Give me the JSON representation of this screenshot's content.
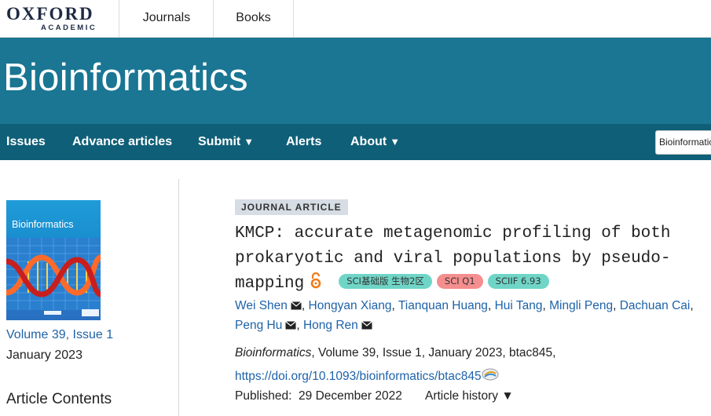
{
  "topbar": {
    "logo_main": "OXFORD",
    "logo_sub": "ACADEMIC",
    "links": [
      "Journals",
      "Books"
    ]
  },
  "banner": {
    "title": "Bioinformatics"
  },
  "nav": {
    "items": [
      {
        "label": "Issues",
        "dropdown": false
      },
      {
        "label": "Advance articles",
        "dropdown": false
      },
      {
        "label": "Submit",
        "dropdown": true
      },
      {
        "label": "Alerts",
        "dropdown": false
      },
      {
        "label": "About",
        "dropdown": true
      }
    ],
    "search_value": "Bioinformatics"
  },
  "sidebar": {
    "cover_title": "Bioinformatics",
    "volume_link": "Volume 39, Issue 1",
    "date": "January 2023",
    "contents_heading": "Article Contents"
  },
  "article": {
    "type_tag": "JOURNAL ARTICLE",
    "title": "KMCP: accurate metagenomic profiling of both prokaryotic and viral populations by pseudo-mapping",
    "badges": [
      "SCI基础版 生物2区",
      "SCI Q1",
      "SCIIF 6.93"
    ],
    "authors": [
      "Wei Shen",
      "Hongyan Xiang",
      "Tianquan Huang",
      "Hui Tang",
      "Mingli Peng",
      "Dachuan Cai",
      "Peng Hu",
      "Hong Ren"
    ],
    "authors_with_mail": [
      "Wei Shen",
      "Peng Hu",
      "Hong Ren"
    ],
    "journal_name": "Bioinformatics",
    "citation_rest": ", Volume 39, Issue 1, January 2023, btac845,",
    "doi": "https://doi.org/10.1093/bioinformatics/btac845",
    "published_label": "Published:",
    "published_date": "29 December 2022",
    "history_label": "Article history"
  },
  "colors": {
    "banner": "#1a7693",
    "nav": "#0f5f78",
    "link": "#1e62a8",
    "badge_teal": "#6fd5c7",
    "badge_red": "#f58e8e",
    "tag_bg": "#d7dde5"
  }
}
